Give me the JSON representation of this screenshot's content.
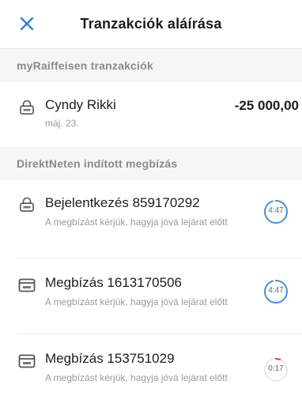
{
  "header": {
    "title": "Tranzakciók aláírása"
  },
  "sections": {
    "my_raiffeisen": {
      "title": "myRaiffeisen tranzakciók",
      "items": [
        {
          "name": "Cyndy Rikki",
          "date": "máj. 23.",
          "amount": "-25 000,00",
          "icon": "lock-icon"
        }
      ]
    },
    "direktnet": {
      "title": "DirektNeten indított megbízás",
      "items": [
        {
          "title": "Bejelentkezés 859170292",
          "subtitle": "A megbízást kérjük, hagyja jóvá lejárat előtt",
          "timer": "4:47",
          "timer_fraction": 0.95,
          "timer_color": "#4a90e2",
          "icon": "lock-icon"
        },
        {
          "title": "Megbízás 1613170506",
          "subtitle": "A megbízást kérjük, hagyja jóvá lejárat előtt",
          "timer": "4:47",
          "timer_fraction": 0.95,
          "timer_color": "#4a90e2",
          "icon": "card-icon"
        },
        {
          "title": "Megbízás 153751029",
          "subtitle": "A megbízást kérjük, hagyja jóvá lejárat előtt",
          "timer": "0:17",
          "timer_fraction": 0.06,
          "timer_color": "#e53935",
          "icon": "card-icon"
        }
      ]
    }
  },
  "colors": {
    "accent_blue": "#2f7fd6",
    "timer_blue": "#4a90e2",
    "timer_red": "#e53935",
    "section_bg": "#f6f6f6"
  }
}
